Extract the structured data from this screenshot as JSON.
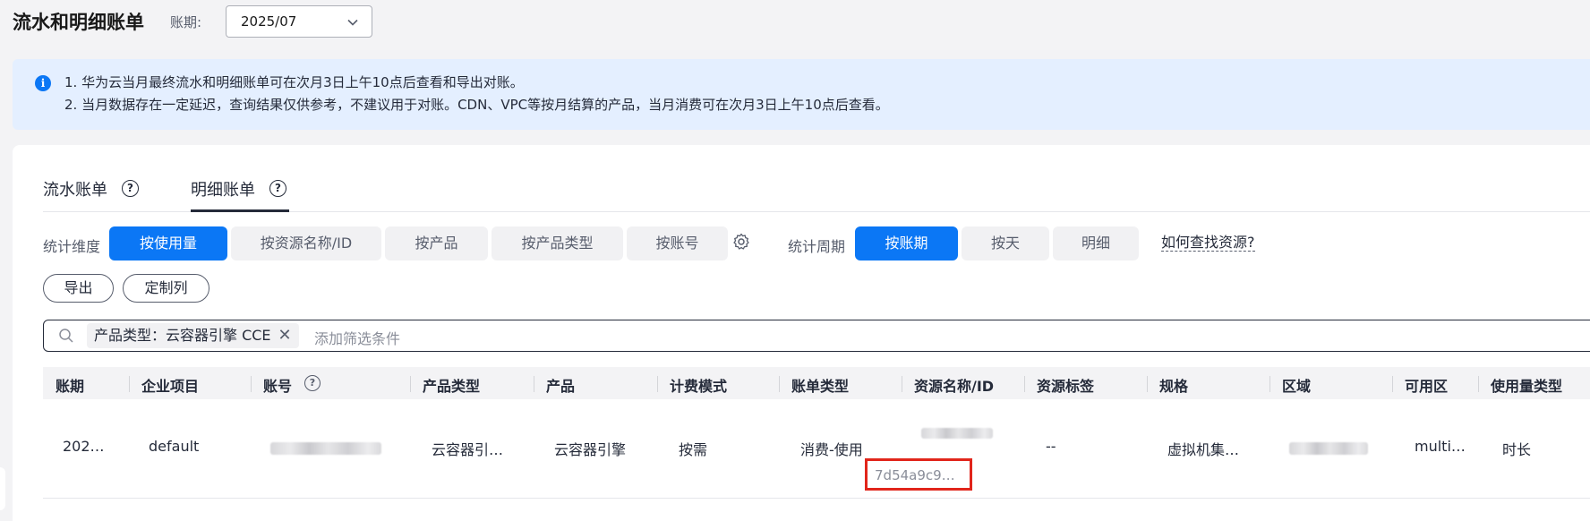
{
  "header": {
    "title": "流水和明细账单",
    "period_label": "账期:",
    "period_value": "2025/07"
  },
  "notice": {
    "line1": "1. 华为云当月最终流水和明细账单可在次月3日上午10点后查看和导出对账。",
    "line2": "2. 当月数据存在一定延迟，查询结果仅供参考，不建议用于对账。CDN、VPC等按月结算的产品，当月消费可在次月3日上午10点后查看。"
  },
  "tabs": [
    {
      "label": "流水账单",
      "active": false
    },
    {
      "label": "明细账单",
      "active": true
    }
  ],
  "stat_dimension": {
    "label": "统计维度",
    "options": [
      "按使用量",
      "按资源名称/ID",
      "按产品",
      "按产品类型",
      "按账号"
    ],
    "selected": "按使用量"
  },
  "stat_period": {
    "label": "统计周期",
    "options": [
      "按账期",
      "按天",
      "明细"
    ],
    "selected": "按账期"
  },
  "help_link": "如何查找资源?",
  "actions": {
    "export": "导出",
    "customize_columns": "定制列"
  },
  "filter": {
    "tag": "产品类型：云容器引擎 CCE",
    "placeholder": "添加筛选条件"
  },
  "table": {
    "columns": [
      "账期",
      "企业项目",
      "账号",
      "产品类型",
      "产品",
      "计费模式",
      "账单类型",
      "资源名称/ID",
      "资源标签",
      "规格",
      "区域",
      "可用区",
      "使用量类型"
    ],
    "rows": [
      {
        "period": "202…",
        "enterprise_project": "default",
        "account": "",
        "product_type": "云容器引…",
        "product": "云容器引擎",
        "billing_mode": "按需",
        "bill_type": "消费-使用",
        "resource_name": "",
        "resource_id": "7d54a9c9…",
        "resource_tags": "--",
        "spec": "虚拟机集…",
        "region": "",
        "az": "multi…",
        "usage_type": "时长"
      }
    ]
  },
  "colors": {
    "primary": "#0b77f5",
    "notice_bg": "#e4efff",
    "highlight_box": "#e1251b"
  }
}
